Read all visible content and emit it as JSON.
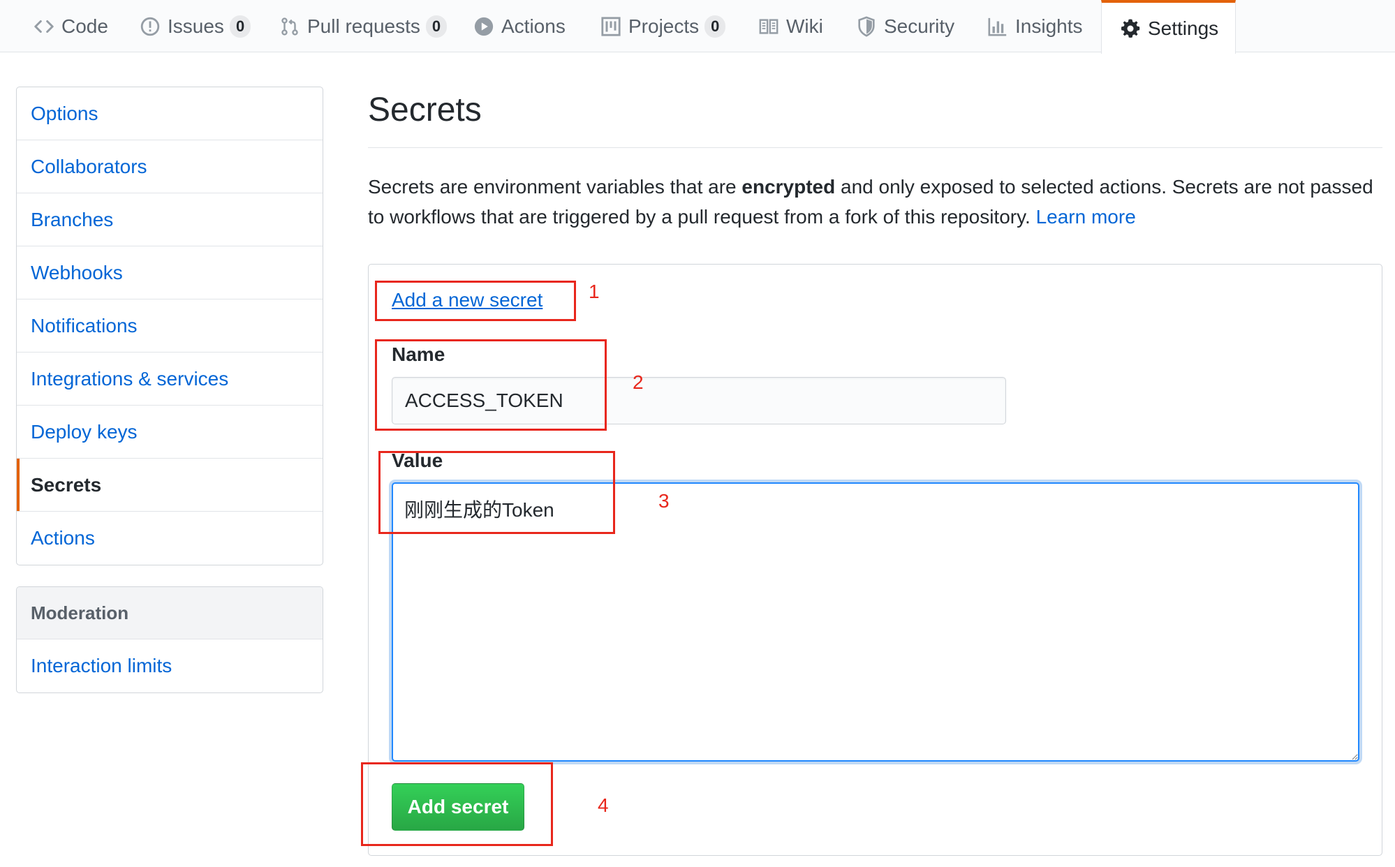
{
  "nav": {
    "tabs": [
      {
        "label": "Code",
        "icon": "code-icon"
      },
      {
        "label": "Issues",
        "icon": "issue-icon",
        "count": "0"
      },
      {
        "label": "Pull requests",
        "icon": "pull-request-icon",
        "count": "0"
      },
      {
        "label": "Actions",
        "icon": "play-icon"
      },
      {
        "label": "Projects",
        "icon": "project-icon",
        "count": "0"
      },
      {
        "label": "Wiki",
        "icon": "book-icon"
      },
      {
        "label": "Security",
        "icon": "shield-icon"
      },
      {
        "label": "Insights",
        "icon": "graph-icon"
      },
      {
        "label": "Settings",
        "icon": "gear-icon",
        "selected": true
      }
    ]
  },
  "sidebar": {
    "items": [
      "Options",
      "Collaborators",
      "Branches",
      "Webhooks",
      "Notifications",
      "Integrations & services",
      "Deploy keys",
      "Secrets",
      "Actions"
    ],
    "selected": "Secrets",
    "moderation": {
      "heading": "Moderation",
      "items": [
        "Interaction limits"
      ]
    }
  },
  "main": {
    "title": "Secrets",
    "description": {
      "part1": "Secrets are environment variables that are ",
      "bold": "encrypted",
      "part2": " and only exposed to selected actions. Secrets are not passed to workflows that are triggered by a pull request from a fork of this repository. ",
      "link": "Learn more"
    },
    "form": {
      "add_link": "Add a new secret",
      "name_label": "Name",
      "name_value": "ACCESS_TOKEN",
      "value_label": "Value",
      "value_text": "刚刚生成的Token",
      "submit_label": "Add secret"
    }
  },
  "annotations": [
    "1",
    "2",
    "3",
    "4"
  ],
  "colors": {
    "accent": "#e36209",
    "link": "#0366d6",
    "primary_button": "#28a745",
    "annotation": "#e8271c",
    "focus": "#2188ff"
  }
}
